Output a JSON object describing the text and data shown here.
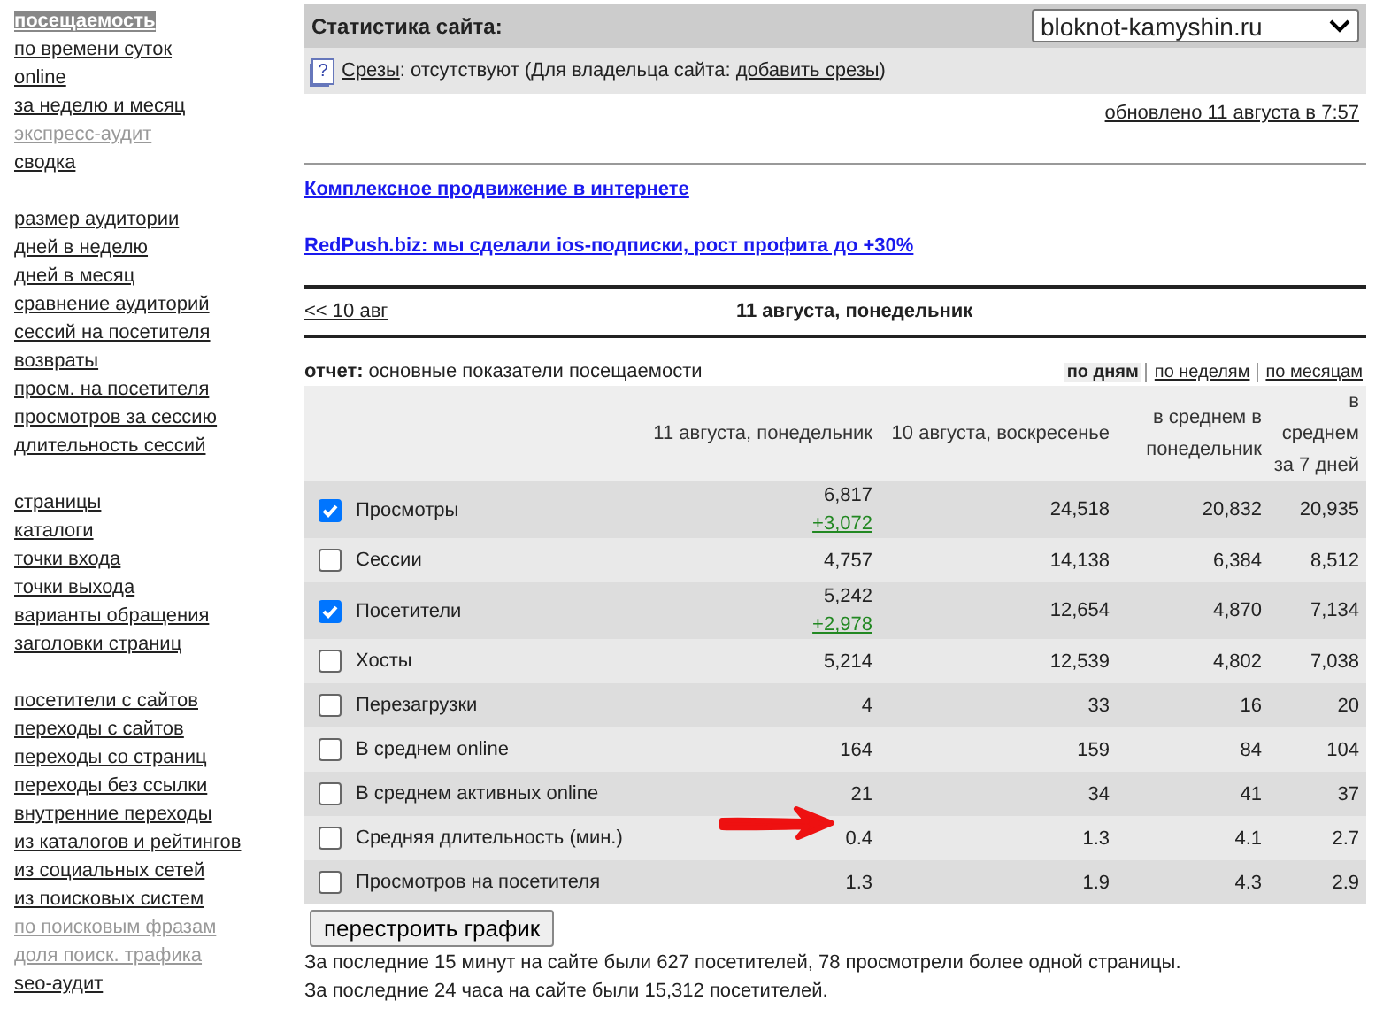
{
  "sidebar": {
    "groups": [
      {
        "items": [
          {
            "label": "посещаемость",
            "selected": true,
            "disabled": false
          },
          {
            "label": "по времени суток",
            "selected": false,
            "disabled": false
          },
          {
            "label": "online",
            "selected": false,
            "disabled": false
          },
          {
            "label": "за неделю и месяц",
            "selected": false,
            "disabled": false
          },
          {
            "label": "экспресс-аудит",
            "selected": false,
            "disabled": true
          },
          {
            "label": "сводка",
            "selected": false,
            "disabled": false
          }
        ]
      },
      {
        "items": [
          {
            "label": "размер аудитории",
            "selected": false,
            "disabled": false
          },
          {
            "label": "дней в неделю",
            "selected": false,
            "disabled": false
          },
          {
            "label": "дней в месяц",
            "selected": false,
            "disabled": false
          },
          {
            "label": "сравнение аудиторий",
            "selected": false,
            "disabled": false
          },
          {
            "label": "сессий на посетителя",
            "selected": false,
            "disabled": false
          },
          {
            "label": "возвраты",
            "selected": false,
            "disabled": false
          },
          {
            "label": "просм. на посетителя",
            "selected": false,
            "disabled": false
          },
          {
            "label": "просмотров за сессию",
            "selected": false,
            "disabled": false
          },
          {
            "label": "длительность сессий",
            "selected": false,
            "disabled": false
          }
        ]
      },
      {
        "items": [
          {
            "label": "страницы",
            "selected": false,
            "disabled": false
          },
          {
            "label": "каталоги",
            "selected": false,
            "disabled": false
          },
          {
            "label": "точки входа",
            "selected": false,
            "disabled": false
          },
          {
            "label": "точки выхода",
            "selected": false,
            "disabled": false
          },
          {
            "label": "варианты обращения",
            "selected": false,
            "disabled": false
          },
          {
            "label": "заголовки страниц",
            "selected": false,
            "disabled": false
          }
        ]
      },
      {
        "items": [
          {
            "label": "посетители с сайтов",
            "selected": false,
            "disabled": false
          },
          {
            "label": "переходы с сайтов",
            "selected": false,
            "disabled": false
          },
          {
            "label": "переходы со страниц",
            "selected": false,
            "disabled": false
          },
          {
            "label": "переходы без ссылки",
            "selected": false,
            "disabled": false
          },
          {
            "label": "внутренние переходы",
            "selected": false,
            "disabled": false
          },
          {
            "label": "из каталогов и рейтингов",
            "selected": false,
            "disabled": false
          },
          {
            "label": "из социальных сетей",
            "selected": false,
            "disabled": false
          },
          {
            "label": "из поисковых систем",
            "selected": false,
            "disabled": false
          },
          {
            "label": "по поисковым фразам",
            "selected": false,
            "disabled": true
          },
          {
            "label": "доля поиск. трафика",
            "selected": false,
            "disabled": true
          },
          {
            "label": "seo-аудит",
            "selected": false,
            "disabled": false
          }
        ]
      }
    ]
  },
  "header": {
    "title": "Статистика сайта:",
    "site_select": "bloknot-kamyshin.ru"
  },
  "slices": {
    "icon": "?",
    "link": "Срезы",
    "text": ": отсутствуют (Для владельца сайта: ",
    "owner_link": "добавить срезы",
    "tail": ")"
  },
  "updated": "обновлено 11 августа в 7:57",
  "ads": [
    "Комплексное продвижение в интернете",
    "RedPush.biz: мы сделали ios-подписки, рост профита до +30%"
  ],
  "date_nav": {
    "prev": "<< 10 авг",
    "current": "11 августа, понедельник"
  },
  "report": {
    "label": "отчет:",
    "name": "основные показатели посещаемости",
    "periods": [
      {
        "label": "по дням",
        "selected": true
      },
      {
        "label": "по неделям",
        "selected": false
      },
      {
        "label": "по месяцам",
        "selected": false
      }
    ]
  },
  "table": {
    "columns": [
      "11 августа, понедельник",
      "10 августа, воскресенье",
      "в среднем в понедельник",
      "в среднем за 7 дней"
    ],
    "rows": [
      {
        "label": "Просмотры",
        "checked": true,
        "values": [
          "6,817",
          "24,518",
          "20,832",
          "20,935"
        ],
        "delta": "+3,072"
      },
      {
        "label": "Сессии",
        "checked": false,
        "values": [
          "4,757",
          "14,138",
          "6,384",
          "8,512"
        ]
      },
      {
        "label": "Посетители",
        "checked": true,
        "values": [
          "5,242",
          "12,654",
          "4,870",
          "7,134"
        ],
        "delta": "+2,978"
      },
      {
        "label": "Хосты",
        "checked": false,
        "values": [
          "5,214",
          "12,539",
          "4,802",
          "7,038"
        ]
      },
      {
        "label": "Перезагрузки",
        "checked": false,
        "values": [
          "4",
          "33",
          "16",
          "20"
        ]
      },
      {
        "label": "В среднем online",
        "checked": false,
        "values": [
          "164",
          "159",
          "84",
          "104"
        ]
      },
      {
        "label": "В среднем активных online",
        "checked": false,
        "values": [
          "21",
          "34",
          "41",
          "37"
        ]
      },
      {
        "label": "Средняя длительность (мин.)",
        "checked": false,
        "values": [
          "0.4",
          "1.3",
          "4.1",
          "2.7"
        ]
      },
      {
        "label": "Просмотров на посетителя",
        "checked": false,
        "values": [
          "1.3",
          "1.9",
          "4.3",
          "2.9"
        ]
      }
    ]
  },
  "rebuild_button": "перестроить график",
  "summary": [
    "За последние 15 минут на сайте были 627 посетителей, 78 просмотрели более одной страницы.",
    "За последние 24 часа на сайте были 15,312 посетителей."
  ]
}
